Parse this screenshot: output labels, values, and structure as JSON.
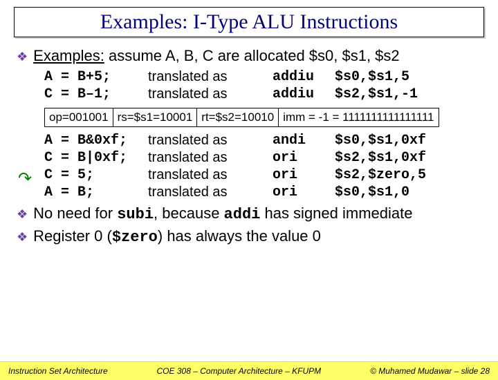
{
  "title": "Examples: I-Type ALU Instructions",
  "bullet1_pre": "Examples:",
  "bullet1_rest": " assume A, B, C are allocated $s0, $s1, $s2",
  "rows1": [
    {
      "src": "A = B+5;",
      "tr": "translated as",
      "op": "addiu",
      "args": "$s0,$s1,5"
    },
    {
      "src": "C = B–1;",
      "tr": "translated as",
      "op": "addiu",
      "args": "$s2,$s1,-1"
    }
  ],
  "enc": {
    "op": "op=001001",
    "rs": "rs=$s1=10001",
    "rt": "rt=$s2=10010",
    "imm": "imm = -1 = 1111111111111111"
  },
  "rows2": [
    {
      "src": "A = B&0xf;",
      "tr": "translated as",
      "op": "andi",
      "args": "$s0,$s1,0xf"
    },
    {
      "src": "C = B|0xf;",
      "tr": "translated as",
      "op": "ori",
      "args": "$s2,$s1,0xf"
    },
    {
      "src": "C = 5;",
      "tr": "translated as",
      "op": "ori",
      "args": "$s2,$zero,5"
    },
    {
      "src": "A = B;",
      "tr": "translated as",
      "op": "ori",
      "args": "$s0,$s1,0"
    }
  ],
  "bullet2": {
    "p1": "No need for ",
    "code1": "subi",
    "p2": ", because ",
    "code2": "addi",
    "p3": " has signed immediate"
  },
  "bullet3": {
    "p1": "Register 0 (",
    "code1": "$zero",
    "p2": ") has always the value 0"
  },
  "footer": {
    "left": "Instruction Set Architecture",
    "center": "COE 308 – Computer Architecture – KFUPM",
    "right": "© Muhamed Mudawar – slide 28"
  }
}
